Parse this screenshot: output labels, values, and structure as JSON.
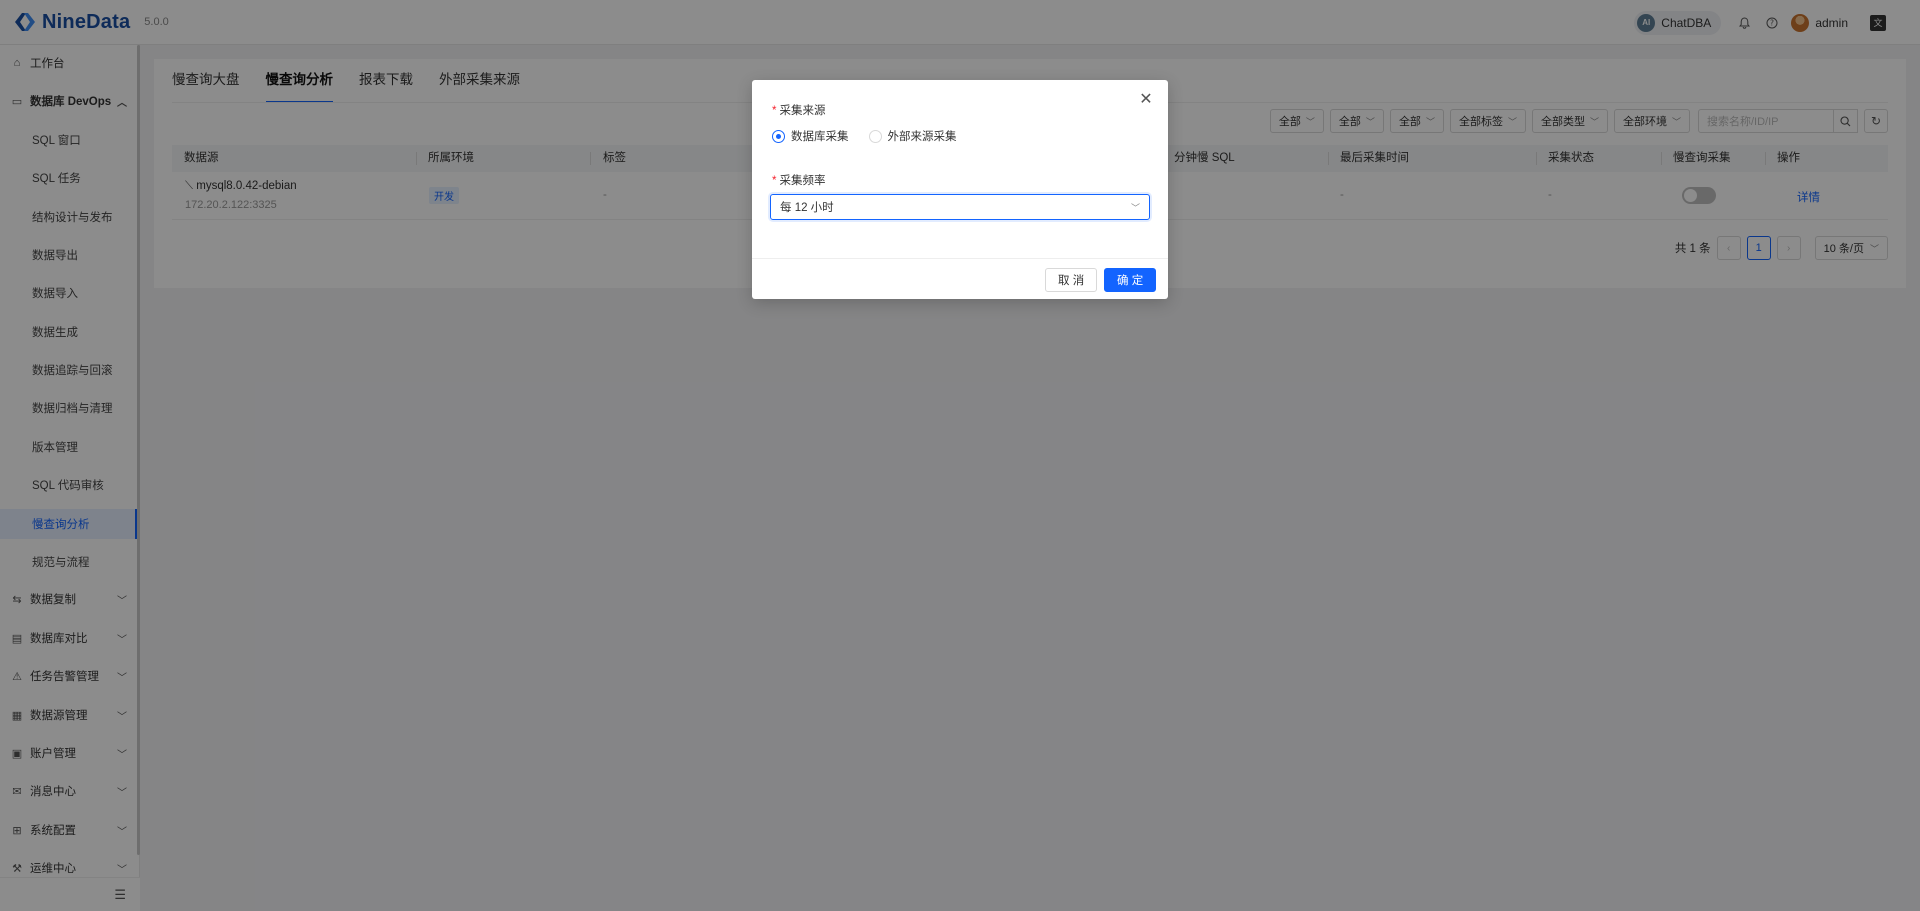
{
  "header": {
    "logo_text": "NineData",
    "version": "5.0.0",
    "chatdba_badge": "AI",
    "chatdba_label": "ChatDBA",
    "user_name": "admin",
    "lang_icon": "文"
  },
  "sidebar": {
    "workbench": "工作台",
    "devops_group": "数据库 DevOps",
    "sub_items": [
      "SQL 窗口",
      "SQL 任务",
      "结构设计与发布",
      "数据导出",
      "数据导入",
      "数据生成",
      "数据追踪与回滚",
      "数据归档与清理",
      "版本管理",
      "SQL 代码审核",
      "慢查询分析",
      "规范与流程"
    ],
    "groups": [
      "数据复制",
      "数据库对比",
      "任务告警管理",
      "数据源管理",
      "账户管理",
      "消息中心",
      "系统配置",
      "运维中心"
    ],
    "active": "慢查询分析"
  },
  "tabs": [
    "慢查询大盘",
    "慢查询分析",
    "报表下载",
    "外部采集来源"
  ],
  "active_tab": "慢查询分析",
  "filters": {
    "selects": [
      "全部",
      "全部",
      "全部",
      "全部标签",
      "全部类型",
      "全部环境"
    ],
    "search_placeholder": "搜索名称/ID/IP"
  },
  "table": {
    "headers": [
      "数据源",
      "所属环境",
      "标签",
      "分钟慢 SQL",
      "最后采集时间",
      "采集状态",
      "慢查询采集",
      "操作"
    ],
    "row": {
      "name": "mysql8.0.42-debian",
      "ip": "172.20.2.122:3325",
      "env": "开发",
      "tag": "-",
      "last_time": "-",
      "status": "-",
      "collect_enabled": false,
      "action": "详情"
    }
  },
  "pagination": {
    "total": "共 1 条",
    "current": "1",
    "page_size": "10 条/页"
  },
  "modal": {
    "source_label": "采集来源",
    "options": [
      "数据库采集",
      "外部来源采集"
    ],
    "selected_option": "数据库采集",
    "freq_label": "采集频率",
    "freq_value": "每 12 小时",
    "cancel": "取 消",
    "ok": "确 定"
  },
  "colors": {
    "primary": "#1364ff",
    "logo": "#1a4fa3",
    "required": "#f5222d"
  }
}
